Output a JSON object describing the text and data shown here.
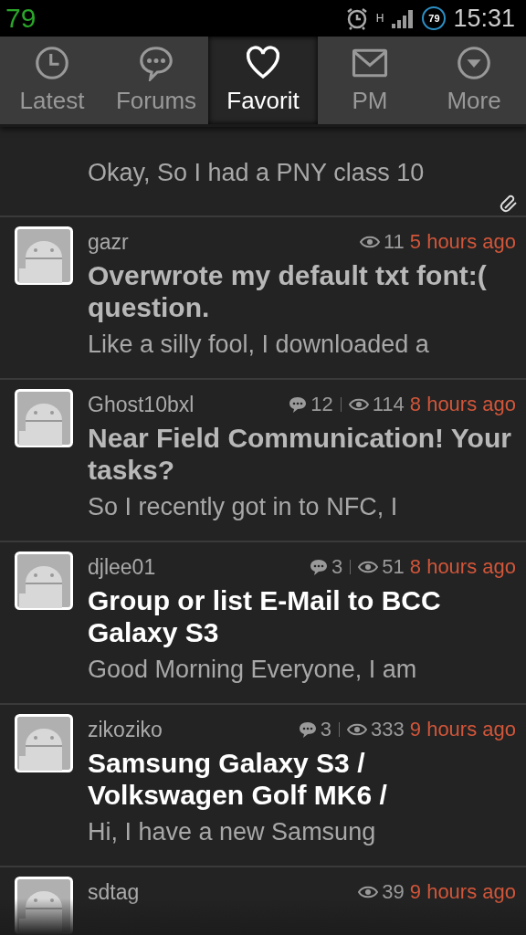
{
  "status_bar": {
    "battery_number": "79",
    "network": "H",
    "battery_percent": "79",
    "time": "15:31"
  },
  "tabs": [
    {
      "label": "Latest",
      "kind": "latest",
      "selected": false
    },
    {
      "label": "Forums",
      "kind": "forums",
      "selected": false
    },
    {
      "label": "Favorit",
      "kind": "favorites",
      "selected": true
    },
    {
      "label": "PM",
      "kind": "messages",
      "selected": false
    },
    {
      "label": "More",
      "kind": "more",
      "selected": false
    }
  ],
  "clipped_topic": {
    "preview": "Okay, So I had a PNY class 10",
    "attachment": true
  },
  "topics": [
    {
      "author": "gazr",
      "views": "11",
      "time": "5 hours ago",
      "title": "Overwrote my default txt font:( question.",
      "preview": "Like a silly fool, I downloaded a",
      "unread": false
    },
    {
      "author": "Ghost10bxl",
      "replies": "12",
      "views": "114",
      "time": "8 hours ago",
      "title": "Near Field Communication! Your tasks?",
      "preview": "So I recently got in to NFC, I",
      "unread": false
    },
    {
      "author": "djlee01",
      "replies": "3",
      "views": "51",
      "time": "8 hours ago",
      "title": "Group or list E-Mail to BCC Galaxy S3",
      "preview": "Good Morning Everyone, I am",
      "unread": true
    },
    {
      "author": "zikoziko",
      "replies": "3",
      "views": "333",
      "time": "9 hours ago",
      "title": "Samsung Galaxy S3 / Volkswagen Golf MK6 /",
      "preview": "Hi, I have a new Samsung",
      "unread": true
    },
    {
      "author": "sdtag",
      "views": "39",
      "time": "9 hours ago"
    }
  ]
}
